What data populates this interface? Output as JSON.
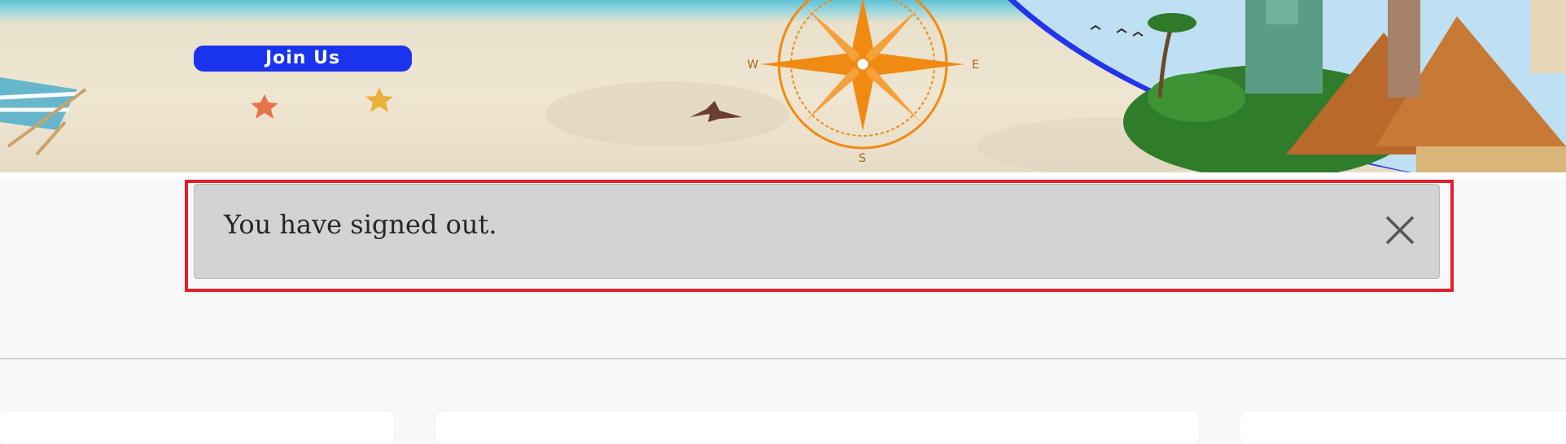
{
  "banner": {
    "join_label": "Join Us",
    "compass": {
      "west": "W",
      "east": "E",
      "south": "S"
    }
  },
  "flash": {
    "message": "You have signed out.",
    "close_icon": "close-icon"
  },
  "colors": {
    "join_button": "#1a34ee",
    "flash_background": "#d3d3d3",
    "highlight_outline": "#e0202a",
    "compass": "#f08a12",
    "page_background": "#f8f9fb"
  }
}
